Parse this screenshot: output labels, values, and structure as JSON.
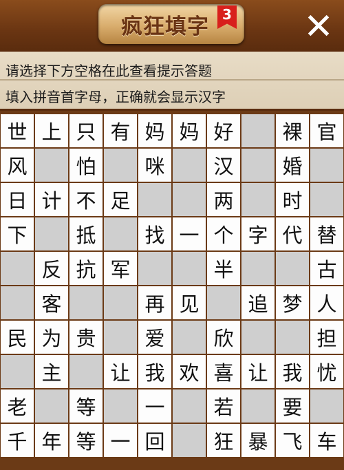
{
  "header": {
    "title": "疯狂填字",
    "level_badge": "3",
    "close_symbol": "✕"
  },
  "hint": {
    "line1": "请选择下方空格在此查看提示答题",
    "line2": "填入拼音首字母，正确就会显示汉字"
  },
  "grid": {
    "rows": [
      [
        "世",
        "上",
        "只",
        "有",
        "妈",
        "妈",
        "好",
        null,
        "裸",
        "官"
      ],
      [
        "风",
        null,
        "怕",
        null,
        "咪",
        null,
        "汉",
        null,
        "婚",
        null
      ],
      [
        "日",
        "计",
        "不",
        "足",
        null,
        null,
        "两",
        null,
        "时",
        null
      ],
      [
        "下",
        null,
        "抵",
        null,
        "找",
        "一",
        "个",
        "字",
        "代",
        "替"
      ],
      [
        null,
        "反",
        "抗",
        "军",
        null,
        null,
        "半",
        null,
        null,
        "古"
      ],
      [
        null,
        "客",
        null,
        null,
        "再",
        "见",
        null,
        "追",
        "梦",
        "人"
      ],
      [
        "民",
        "为",
        "贵",
        null,
        "爱",
        null,
        "欣",
        null,
        null,
        "担"
      ],
      [
        null,
        "主",
        null,
        "让",
        "我",
        "欢",
        "喜",
        "让",
        "我",
        "忧"
      ],
      [
        "老",
        null,
        "等",
        null,
        "一",
        null,
        "若",
        null,
        "要",
        null
      ],
      [
        "千",
        "年",
        "等",
        "一",
        "回",
        null,
        "狂",
        "暴",
        "飞",
        "车"
      ]
    ]
  },
  "colors": {
    "wood": "#6b3a16",
    "cell_filled": "#fdfdfd",
    "cell_empty": "#cfcfcf",
    "badge": "#d8201c"
  }
}
